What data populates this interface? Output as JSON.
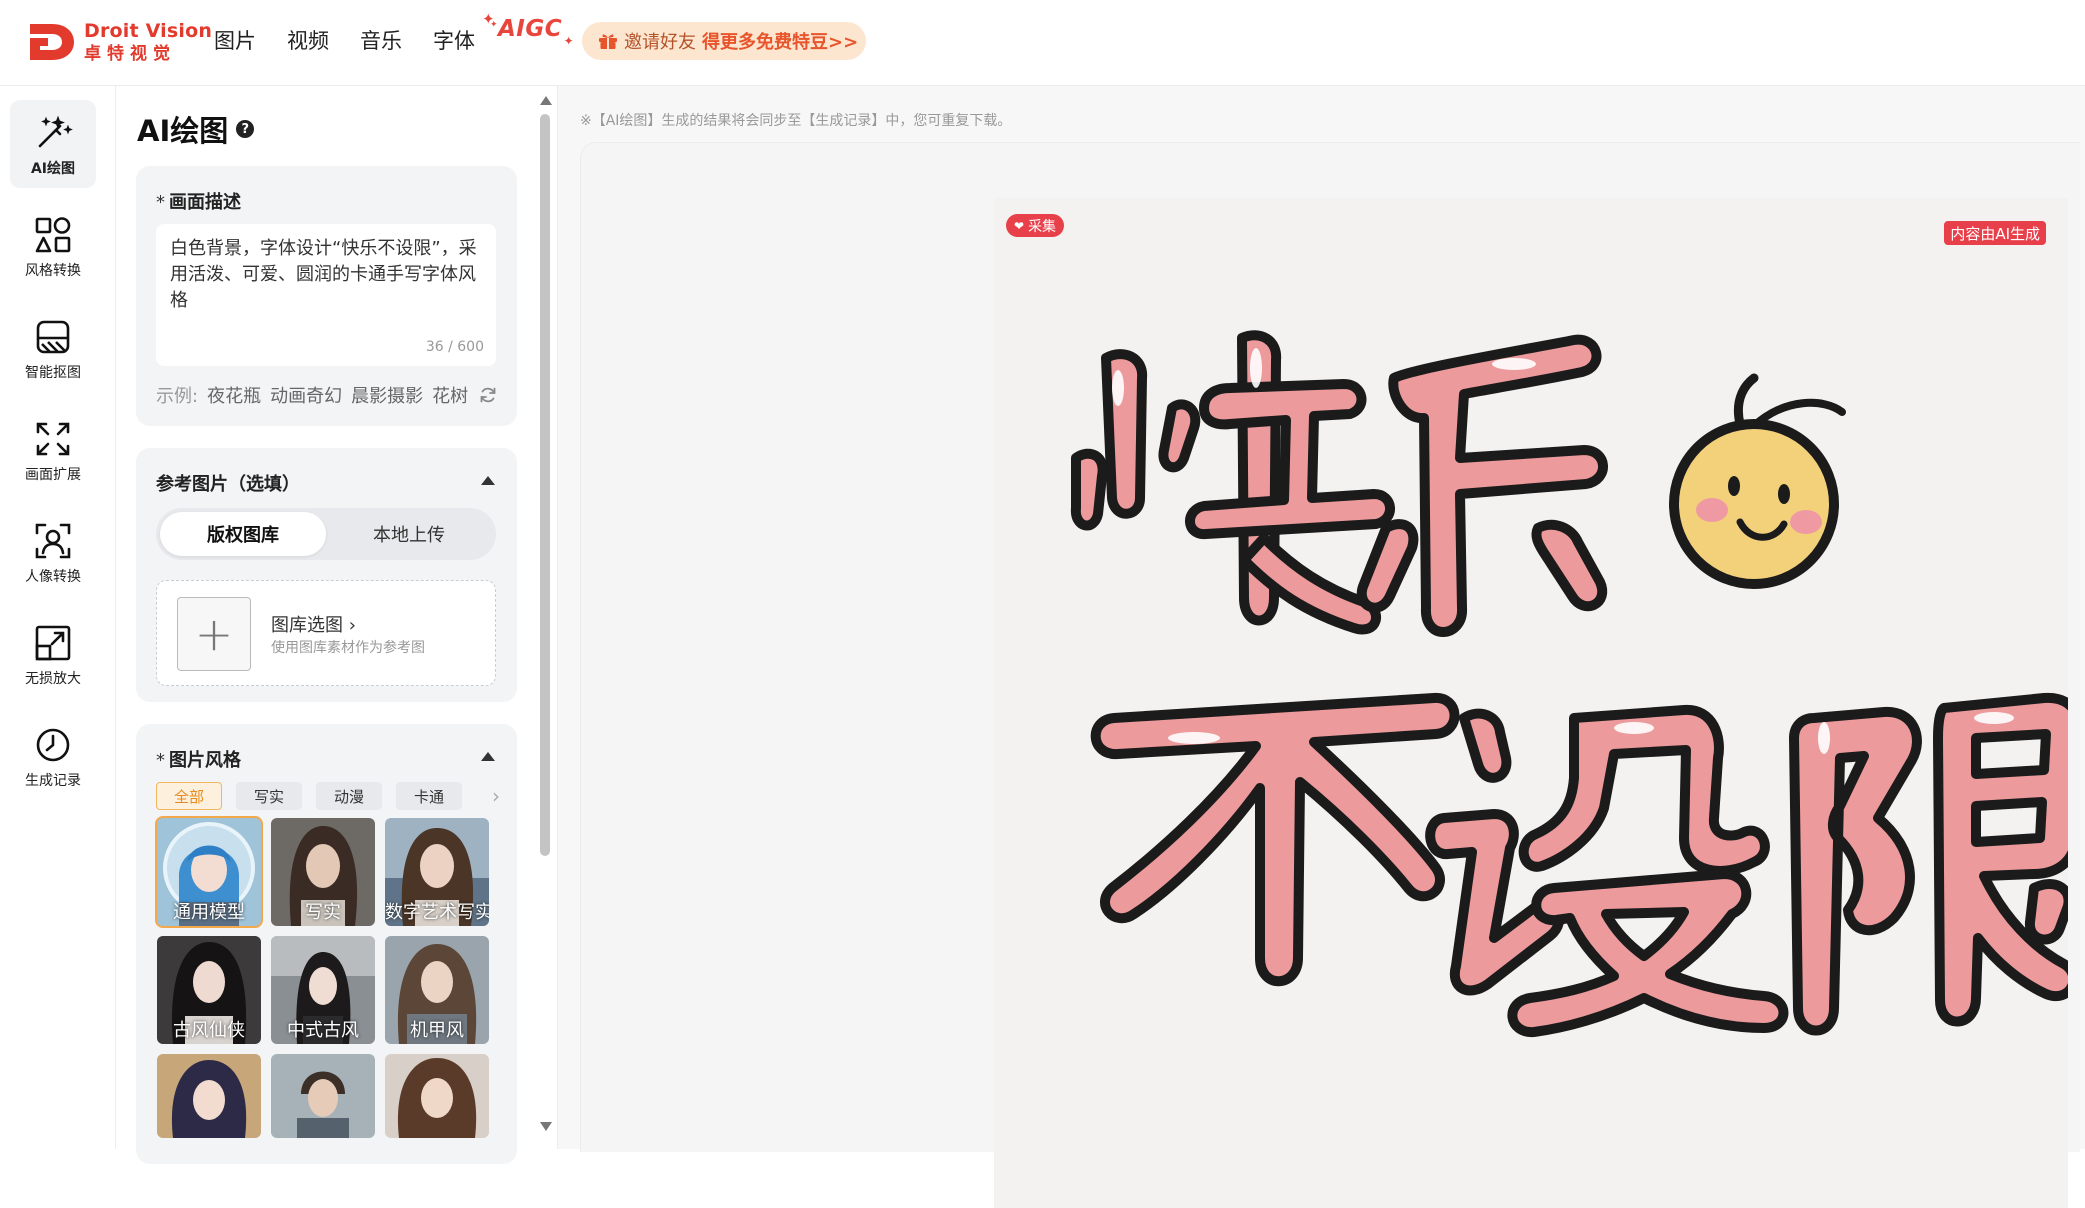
{
  "header": {
    "logo_en": "Droit Vision",
    "logo_cn": "卓特视觉",
    "nav": [
      "图片",
      "视频",
      "音乐",
      "字体"
    ],
    "aigc": "AIGC",
    "invite_prefix": "邀请好友",
    "invite_highlight": "得更多免费特豆>>"
  },
  "sidebar": {
    "items": [
      {
        "label": "AI绘图",
        "icon": "magic-wand-icon",
        "active": true
      },
      {
        "label": "风格转换",
        "icon": "shapes-icon",
        "active": false
      },
      {
        "label": "智能抠图",
        "icon": "cutout-icon",
        "active": false
      },
      {
        "label": "画面扩展",
        "icon": "expand-icon",
        "active": false
      },
      {
        "label": "人像转换",
        "icon": "portrait-scan-icon",
        "active": false
      },
      {
        "label": "无损放大",
        "icon": "enlarge-icon",
        "active": false
      },
      {
        "label": "生成记录",
        "icon": "clock-icon",
        "active": false
      }
    ]
  },
  "panel": {
    "title": "AI绘图",
    "description": {
      "label": "画面描述",
      "required": "*",
      "value": "白色背景，字体设计“快乐不设限”，采用活泼、可爱、圆润的卡通手写字体风格",
      "counter": "36 / 600",
      "examples_label": "示例:",
      "examples": [
        "夜花瓶",
        "动画奇幻",
        "晨影摄影",
        "花树"
      ]
    },
    "reference": {
      "label": "参考图片（选填）",
      "tabs": [
        "版权图库",
        "本地上传"
      ],
      "library_title": "图库选图",
      "library_sub": "使用图库素材作为参考图"
    },
    "style": {
      "label": "图片风格",
      "required": "*",
      "filters": [
        "全部",
        "写实",
        "动漫",
        "卡通"
      ],
      "tiles": [
        "通用模型",
        "写实",
        "数字艺术写实",
        "古风仙侠",
        "中式古风",
        "机甲风",
        "",
        "",
        ""
      ]
    }
  },
  "main": {
    "notice": "※【AI绘图】生成的结果将会同步至【生成记录】中，您可重复下载。",
    "collect_label": "采集",
    "ai_badge": "内容由AI生成"
  },
  "colors": {
    "brand_red": "#e23b2e",
    "accent_orange": "#f3a94a",
    "badge_red": "#e8404b",
    "pink_text": "#ec9a9b"
  }
}
